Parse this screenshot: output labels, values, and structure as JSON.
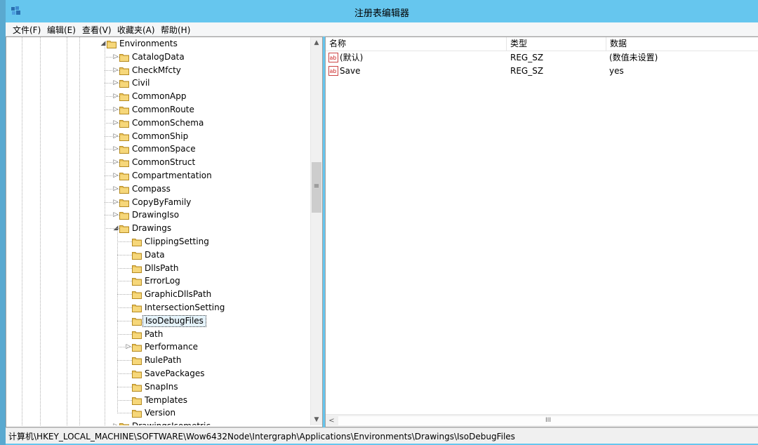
{
  "window": {
    "title": "注册表编辑器",
    "accent": "#66c6ee"
  },
  "menu": [
    "文件(F)",
    "编辑(E)",
    "查看(V)",
    "收藏夹(A)",
    "帮助(H)"
  ],
  "tree": {
    "root": {
      "label": "Environments",
      "expander": "◢"
    },
    "children": [
      {
        "label": "CatalogData",
        "expander": "▷"
      },
      {
        "label": "CheckMfcty",
        "expander": "▷"
      },
      {
        "label": "Civil",
        "expander": "▷"
      },
      {
        "label": "CommonApp",
        "expander": "▷"
      },
      {
        "label": "CommonRoute",
        "expander": "▷"
      },
      {
        "label": "CommonSchema",
        "expander": "▷"
      },
      {
        "label": "CommonShip",
        "expander": "▷"
      },
      {
        "label": "CommonSpace",
        "expander": "▷"
      },
      {
        "label": "CommonStruct",
        "expander": "▷"
      },
      {
        "label": "Compartmentation",
        "expander": "▷"
      },
      {
        "label": "Compass",
        "expander": "▷"
      },
      {
        "label": "CopyByFamily",
        "expander": "▷"
      },
      {
        "label": "DrawingIso",
        "expander": "▷"
      },
      {
        "label": "Drawings",
        "expander": "◢"
      }
    ],
    "drawings_children": [
      {
        "label": "ClippingSetting",
        "expander": ""
      },
      {
        "label": "Data",
        "expander": ""
      },
      {
        "label": "DllsPath",
        "expander": ""
      },
      {
        "label": "ErrorLog",
        "expander": ""
      },
      {
        "label": "GraphicDllsPath",
        "expander": ""
      },
      {
        "label": "IntersectionSetting",
        "expander": ""
      },
      {
        "label": "IsoDebugFiles",
        "expander": "",
        "selected": true
      },
      {
        "label": "Path",
        "expander": ""
      },
      {
        "label": "Performance",
        "expander": "▷"
      },
      {
        "label": "RulePath",
        "expander": ""
      },
      {
        "label": "SavePackages",
        "expander": ""
      },
      {
        "label": "SnapIns",
        "expander": ""
      },
      {
        "label": "Templates",
        "expander": ""
      },
      {
        "label": "Version",
        "expander": ""
      }
    ],
    "partial_next": {
      "label": "DrawingsIsometric",
      "expander": "▷"
    }
  },
  "list": {
    "columns": [
      "名称",
      "类型",
      "数据"
    ],
    "rows": [
      {
        "icon": "string-value-icon",
        "name": "(默认)",
        "type": "REG_SZ",
        "data": "(数值未设置)"
      },
      {
        "icon": "string-value-icon",
        "name": "Save",
        "type": "REG_SZ",
        "data": "yes"
      }
    ]
  },
  "scrollbars": {
    "up": "▲",
    "down": "▼",
    "left": "<",
    "grip_v": "≡",
    "grip_h": "III"
  },
  "status": {
    "path": "计算机\\HKEY_LOCAL_MACHINE\\SOFTWARE\\Wow6432Node\\Intergraph\\Applications\\Environments\\Drawings\\IsoDebugFiles"
  }
}
